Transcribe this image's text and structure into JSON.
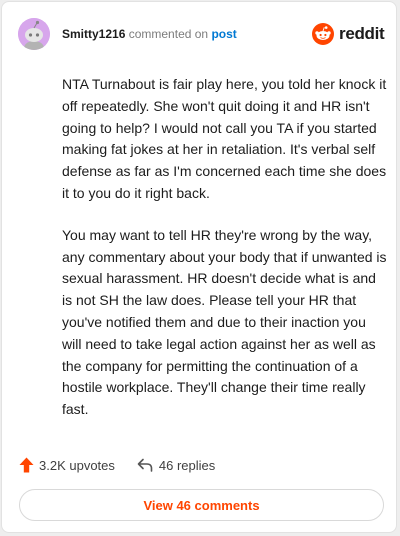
{
  "header": {
    "username": "Smitty1216",
    "commented_text": "commented on",
    "post_link": "post",
    "logo_text": "reddit"
  },
  "comment": {
    "paragraphs": [
      "NTA Turnabout is fair play here, you told her knock it off repeatedly. She won't quit doing it and HR isn't going to help? I would not call you TA if you started making fat jokes at her in retaliation. It's verbal self defense as far as I'm concerned each time she does it to you do it right back.",
      "You may want to tell HR they're wrong by the way, any commentary about your body that if unwanted is sexual harassment. HR doesn't decide what is and is not SH the law does. Please tell your HR that you've notified them and due to their inaction you will need to take legal action against her as well as the company for permitting the continuation of a hostile workplace. They'll change their time really fast."
    ]
  },
  "actions": {
    "upvotes": "3.2K upvotes",
    "replies": "46 replies",
    "view_comments": "View 46 comments"
  },
  "colors": {
    "accent": "#ff4500",
    "link": "#0079d3",
    "avatar_bg": "#d7a6ec"
  },
  "icons": {
    "avatar": "snoo-avatar-icon",
    "logo": "reddit-logo-icon",
    "upvote": "upvote-arrow-icon",
    "reply": "reply-arrow-icon"
  }
}
